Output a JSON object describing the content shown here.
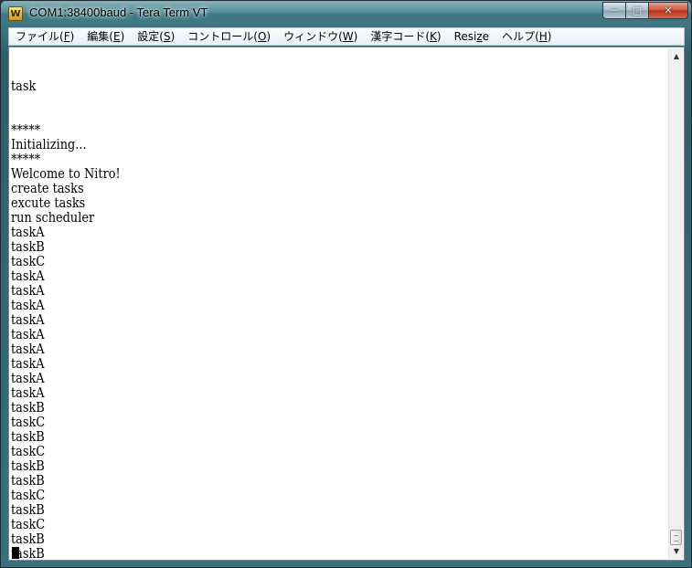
{
  "window": {
    "title": "COM1:38400baud - Tera Term VT",
    "app_icon_glyph": "W",
    "minimize_glyph": "─",
    "maximize_glyph": "□",
    "close_glyph": "✕"
  },
  "menu": [
    {
      "label": "ファイル(",
      "mnemonic": "F",
      "suffix": ")"
    },
    {
      "label": "編集(",
      "mnemonic": "E",
      "suffix": ")"
    },
    {
      "label": "設定(",
      "mnemonic": "S",
      "suffix": ")"
    },
    {
      "label": "コントロール(",
      "mnemonic": "O",
      "suffix": ")"
    },
    {
      "label": "ウィンドウ(",
      "mnemonic": "W",
      "suffix": ")"
    },
    {
      "label": "漢字コード(",
      "mnemonic": "K",
      "suffix": ")"
    },
    {
      "label": "Resi",
      "mnemonic": "z",
      "suffix": "e"
    },
    {
      "label": "ヘルプ(",
      "mnemonic": "H",
      "suffix": ")"
    }
  ],
  "terminal": {
    "lines": [
      "",
      "task",
      "",
      "",
      "*****",
      "Initializing...",
      "*****",
      "Welcome to Nitro!",
      "create tasks",
      "excute tasks",
      "run scheduler",
      "taskA",
      "taskB",
      "taskC",
      "taskA",
      "taskA",
      "taskA",
      "taskA",
      "taskA",
      "taskA",
      "taskA",
      "taskA",
      "taskA",
      "taskB",
      "taskC",
      "taskB",
      "taskC",
      "taskB",
      "taskB",
      "taskC",
      "taskB",
      "taskC",
      "taskB",
      "taskB"
    ]
  },
  "scrollbar": {
    "up_glyph": "▲",
    "down_glyph": "▼"
  }
}
